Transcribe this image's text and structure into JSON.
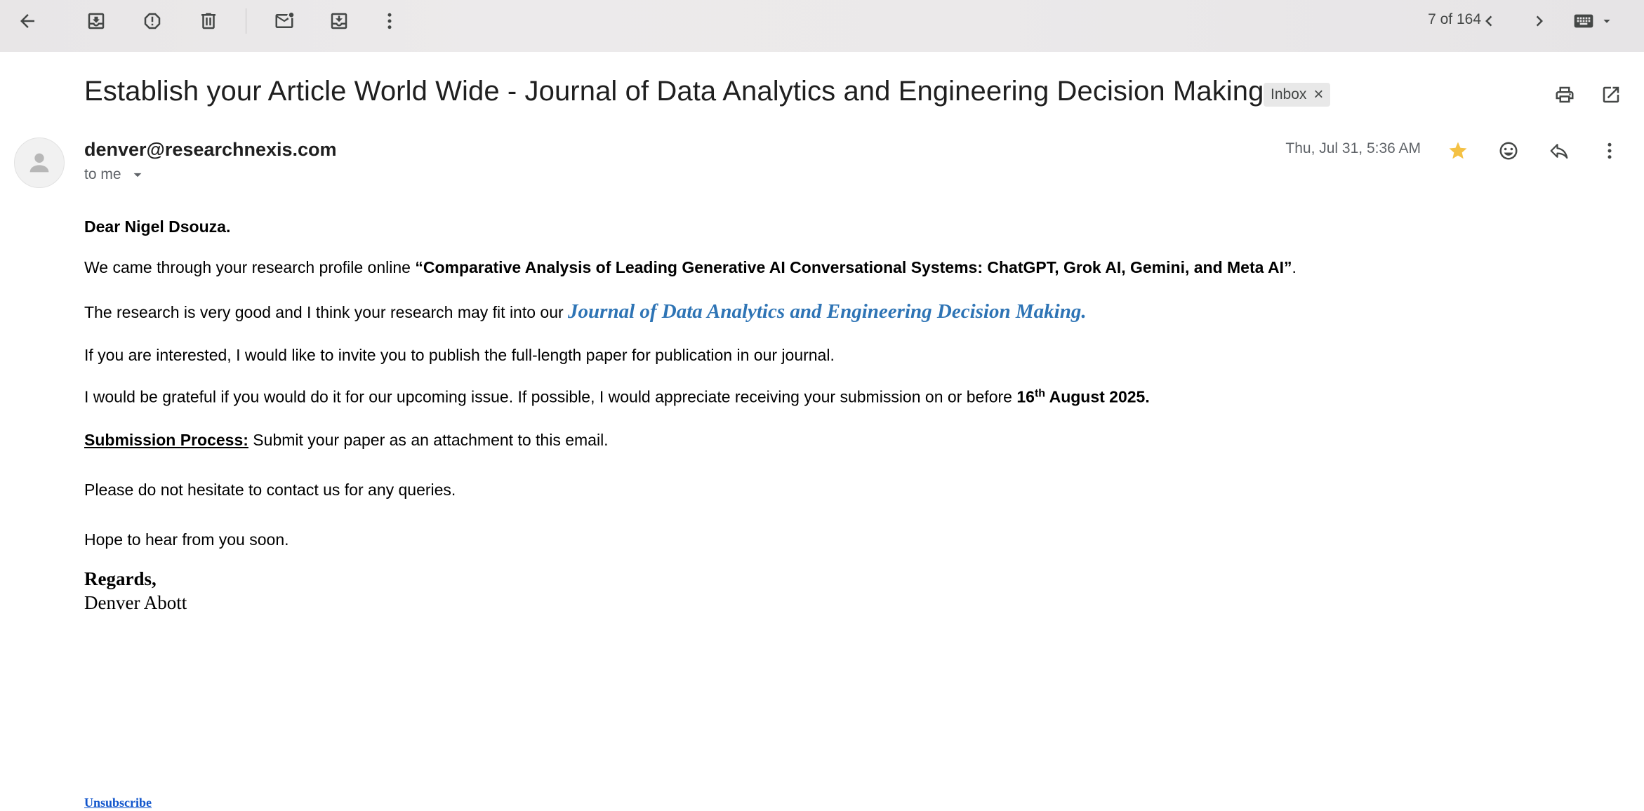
{
  "toolbar": {
    "counter": "7 of 164"
  },
  "email": {
    "subject": "Establish your Article World Wide - Journal of Data Analytics and Engineering Decision Making",
    "label": "Inbox",
    "label_remove": "×",
    "sender": "denver@researchnexis.com",
    "recipient": "to me",
    "date": "Thu, Jul 31, 5:36 AM"
  },
  "body": {
    "greeting": "Dear Nigel Dsouza.",
    "p1_prefix": "We came through your research profile online ",
    "p1_title": "“Comparative Analysis of Leading Generative AI Conversational Systems: ChatGPT, Grok AI, Gemini, and Meta AI”",
    "p1_suffix": ".",
    "p2_prefix": "The research is very good and I think your research may fit into our ",
    "p2_journal": "Journal of Data Analytics and Engineering Decision Making.",
    "p3": "If you are interested, I would like to invite you to publish the full-length paper for publication in our journal.",
    "p4_prefix": "I would be grateful if you would do it for our upcoming issue. If possible, I would appreciate receiving your submission on or before ",
    "p4_day": "16",
    "p4_sup": "th",
    "p4_date": " August 2025",
    "p4_suffix": ".",
    "p5_label": "Submission Process:",
    "p5_text": " Submit your paper as an attachment to this email.",
    "p6": "Please do not hesitate to contact us for any queries.",
    "p7": "Hope to hear from you soon.",
    "regards": "Regards,",
    "signature": "Denver Abott",
    "unsubscribe": "Unsubscribe"
  },
  "colors": {
    "journal_link": "#2e74b5",
    "star": "#f4c144",
    "unsubscribe": "#1155cc"
  },
  "icons": [
    "back-arrow-icon",
    "archive-icon",
    "report-spam-icon",
    "delete-icon",
    "mark-unread-icon",
    "move-to-icon",
    "more-vert-icon",
    "chevron-left-icon",
    "chevron-right-icon",
    "keyboard-icon",
    "print-icon",
    "open-new-window-icon",
    "star-icon",
    "emoji-icon",
    "reply-icon"
  ]
}
